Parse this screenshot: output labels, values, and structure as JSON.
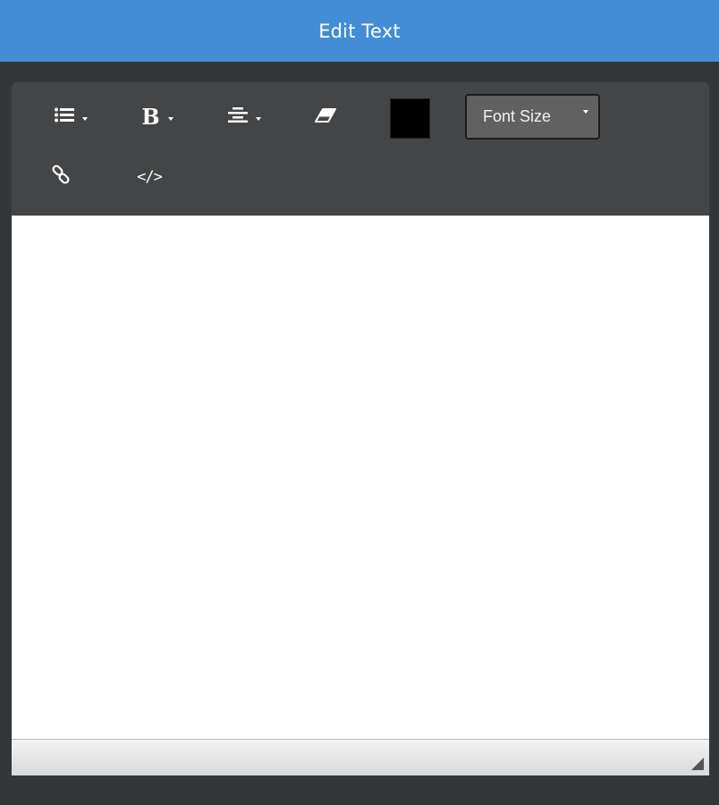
{
  "header": {
    "title": "Edit Text"
  },
  "toolbar": {
    "list_icon": "list-icon",
    "bold_icon": "bold-icon",
    "bold_glyph": "B",
    "align_icon": "align-center-icon",
    "eraser_icon": "eraser-icon",
    "text_color": "#000000",
    "font_size_label": "Font Size",
    "link_icon": "link-icon",
    "code_icon": "code-view-icon",
    "code_glyph": "</>"
  },
  "colors": {
    "header": "#428dd6",
    "toolbar": "#444546",
    "background": "#343739"
  }
}
